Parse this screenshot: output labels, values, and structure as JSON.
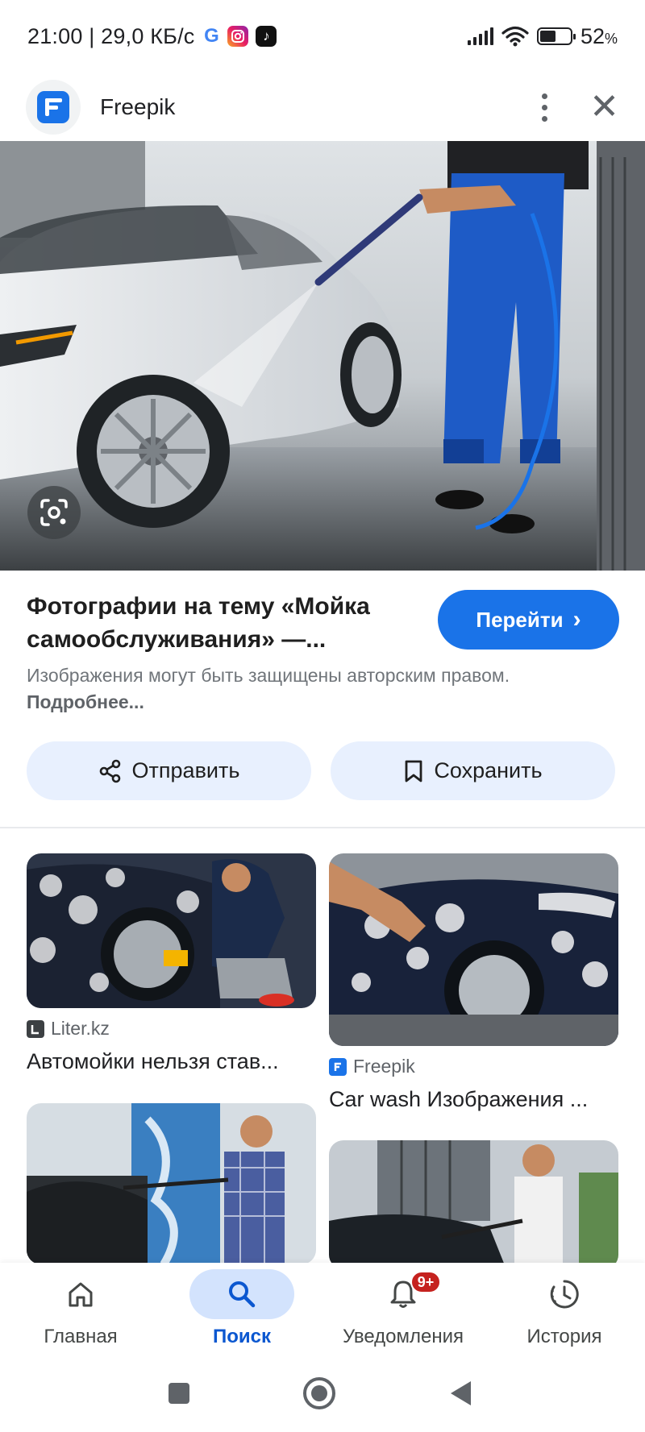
{
  "status_bar": {
    "time_speed": "21:00 | 29,0 КБ/с",
    "app_icons": [
      "google-icon",
      "instagram-icon",
      "tiktok-icon"
    ],
    "battery_percent": "52",
    "battery_unit": "%",
    "battery_level": 0.52
  },
  "header": {
    "site_name": "Freepik"
  },
  "detail": {
    "title": "Фотографии на тему «Мойка самообслуживания» —...",
    "go_button": "Перейти",
    "copyright_text": "Изображения могут быть защищены авторским правом.",
    "copyright_link": "Подробнее..."
  },
  "actions": {
    "share_label": "Отправить",
    "save_label": "Сохранить"
  },
  "results": [
    {
      "source": "Liter.kz",
      "title": "Автомойки нельзя став..."
    },
    {
      "source": "Freepik",
      "title": "Car wash Изображения ..."
    }
  ],
  "bottom_nav": {
    "items": [
      {
        "label": "Главная",
        "icon": "home-icon"
      },
      {
        "label": "Поиск",
        "icon": "search-icon"
      },
      {
        "label": "Уведомления",
        "icon": "bell-icon"
      },
      {
        "label": "История",
        "icon": "history-icon"
      }
    ],
    "notification_badge": "9+"
  },
  "colors": {
    "accent": "#1a73e8",
    "chip_bg": "#e8f0fe",
    "active_nav": "#0b57d0",
    "badge": "#c5221f"
  }
}
